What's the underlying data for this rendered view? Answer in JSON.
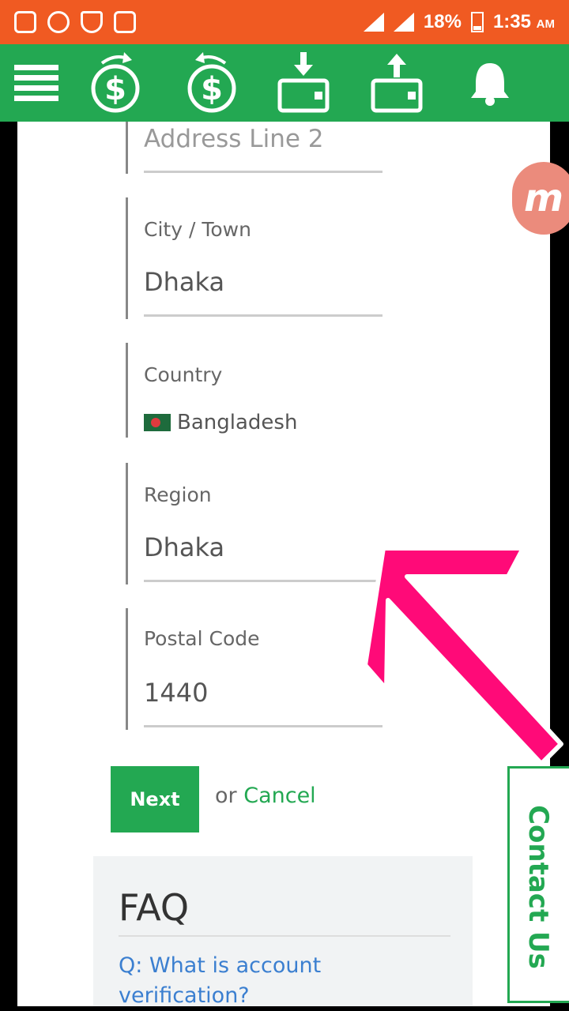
{
  "status_bar": {
    "battery": "18%",
    "time": "1:35",
    "ampm": "AM"
  },
  "app_bar": {
    "icons": [
      "menu-icon",
      "send-money-icon",
      "request-money-icon",
      "deposit-icon",
      "withdraw-icon",
      "bell-icon"
    ]
  },
  "form": {
    "address_line2": {
      "placeholder": "Address Line 2"
    },
    "city": {
      "label": "City / Town",
      "value": "Dhaka"
    },
    "country": {
      "label": "Country",
      "value": "Bangladesh"
    },
    "region": {
      "label": "Region",
      "value": "Dhaka"
    },
    "postal": {
      "label": "Postal Code",
      "value": "1440"
    },
    "next_label": "Next",
    "or_text": "or",
    "cancel_label": "Cancel"
  },
  "faq": {
    "title": "FAQ",
    "question": "Q: What is account verification?"
  },
  "badge": {
    "letter": "m"
  },
  "contact": {
    "label": "Contact Us"
  },
  "colors": {
    "status_bar": "#f05a22",
    "app_bar": "#23a852",
    "accent": "#23a852",
    "link": "#3b7fd0",
    "arrow": "#ff0a78"
  }
}
